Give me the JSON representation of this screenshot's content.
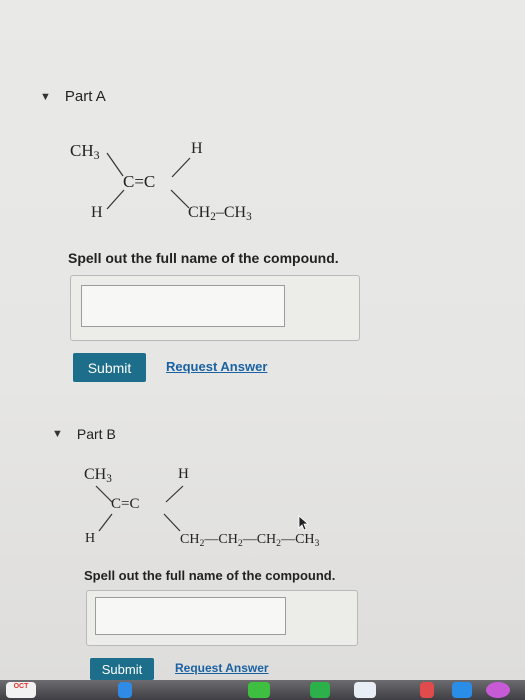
{
  "partA": {
    "title": "Part A",
    "structure": {
      "top_left": "CH3",
      "top_right": "H",
      "center": "C=C",
      "bottom_left": "H",
      "bottom_right_parts": [
        "CH2",
        "CH3"
      ]
    },
    "prompt": "Spell out the full name of the compound.",
    "answer_value": "",
    "submit_label": "Submit",
    "request_answer_label": "Request Answer"
  },
  "partB": {
    "title": "Part B",
    "structure": {
      "top_left": "CH3",
      "top_right": "H",
      "center": "C=C",
      "bottom_left": "H",
      "bottom_right_parts": [
        "CH2",
        "CH2",
        "CH2",
        "CH3"
      ]
    },
    "prompt": "Spell out the full name of the compound.",
    "answer_value": "",
    "submit_label": "Submit",
    "request_answer_label": "Request Answer"
  },
  "dock": {
    "calendar_month": "OCT"
  },
  "colors": {
    "submit_bg": "#1c6e8a",
    "link": "#1b62a3",
    "page_bg": "#e8e8e6"
  }
}
